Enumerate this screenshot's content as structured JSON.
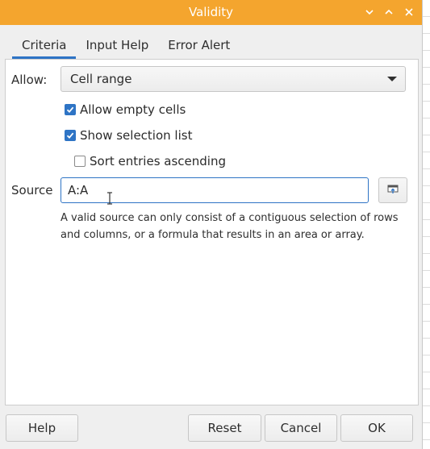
{
  "window": {
    "title": "Validity",
    "controls": [
      "chevron-down-icon",
      "chevron-up-icon",
      "close-icon"
    ],
    "accent": "#f4a52e"
  },
  "tabs": [
    {
      "label": "Criteria",
      "active": true
    },
    {
      "label": "Input Help",
      "active": false
    },
    {
      "label": "Error Alert",
      "active": false
    }
  ],
  "criteria": {
    "allow_label": "Allow:",
    "allow_value": "Cell range",
    "checkboxes": [
      {
        "label": "Allow empty cells",
        "checked": true
      },
      {
        "label": "Show selection list",
        "checked": true
      },
      {
        "label": "Sort entries ascending",
        "checked": false
      }
    ],
    "source_label": "Source",
    "source_value": "A:A",
    "hint": "A valid source can only consist of a contiguous selection of rows and columns, or a formula that results in an area or array."
  },
  "buttons": {
    "help": "Help",
    "reset": "Reset",
    "cancel": "Cancel",
    "ok": "OK"
  },
  "colors": {
    "checkbox_on": "#2e74c5",
    "focus": "#2e74c5"
  }
}
